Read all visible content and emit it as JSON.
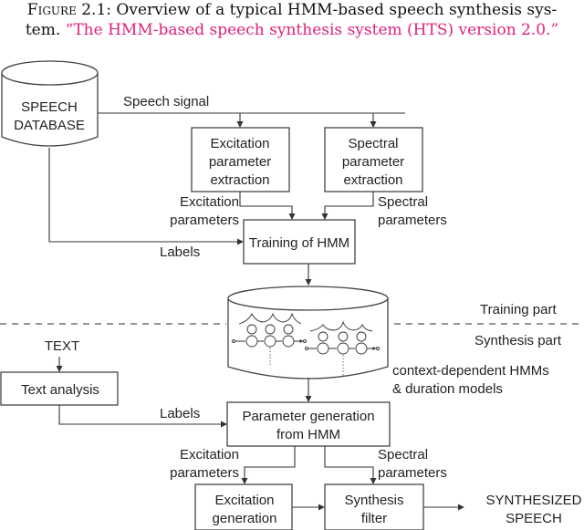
{
  "caption": {
    "label": "Figure 2.1:",
    "text": " Overview of a typical HMM-based speech synthesis sys-",
    "text2": "tem. ",
    "quote": "“The HMM-based speech synthesis system (HTS) version 2.0.”",
    "quote_color": "#e0207a"
  },
  "diagram": {
    "database": [
      "SPEECH",
      "DATABASE"
    ],
    "speech_signal": "Speech signal",
    "excitation_extraction": [
      "Excitation",
      "parameter",
      "extraction"
    ],
    "spectral_extraction": [
      "Spectral",
      "parameter",
      "extraction"
    ],
    "excitation_params_top": [
      "Excitation",
      "parameters"
    ],
    "spectral_params_top": [
      "Spectral",
      "parameters"
    ],
    "labels_top": "Labels",
    "training": "Training of HMM",
    "training_part": "Training part",
    "synthesis_part": "Synthesis part",
    "models_caption": [
      "context-dependent HMMs",
      "& duration models"
    ],
    "text_input": "TEXT",
    "text_analysis": "Text analysis",
    "labels_bottom": "Labels",
    "param_generation": [
      "Parameter generation",
      "from HMM"
    ],
    "excitation_params_bottom": [
      "Excitation",
      "parameters"
    ],
    "spectral_params_bottom": [
      "Spectral",
      "parameters"
    ],
    "excitation_generation": [
      "Excitation",
      "generation"
    ],
    "synthesis_filter": [
      "Synthesis",
      "filter"
    ],
    "output": [
      "SYNTHESIZED",
      "SPEECH"
    ]
  }
}
